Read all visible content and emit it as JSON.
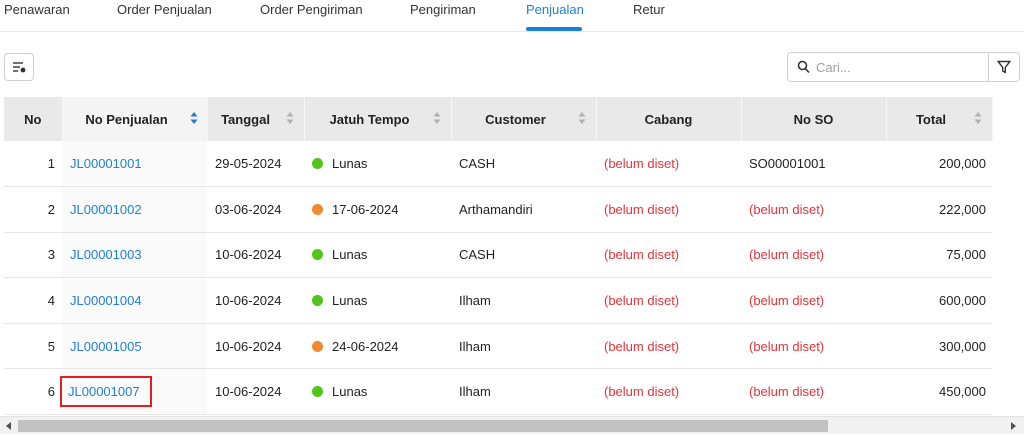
{
  "tabs": [
    {
      "label": "Penawaran",
      "active": false
    },
    {
      "label": "Order Penjualan",
      "active": false
    },
    {
      "label": "Order Pengiriman",
      "active": false
    },
    {
      "label": "Pengiriman",
      "active": false
    },
    {
      "label": "Penjualan",
      "active": true
    },
    {
      "label": "Retur",
      "active": false
    }
  ],
  "toolbar": {
    "filter_icon": "sort-filter-icon",
    "search_placeholder": "Cari...",
    "search_value": "",
    "funnel_icon": "funnel-icon"
  },
  "table": {
    "columns": [
      {
        "label": "No",
        "sortable": false
      },
      {
        "label": "No Penjualan",
        "sortable": true,
        "sorted": "ascending"
      },
      {
        "label": "Tanggal",
        "sortable": true
      },
      {
        "label": "Jatuh Tempo",
        "sortable": true
      },
      {
        "label": "Customer",
        "sortable": true
      },
      {
        "label": "Cabang",
        "sortable": false
      },
      {
        "label": "No SO",
        "sortable": false
      },
      {
        "label": "Total",
        "sortable": true
      }
    ],
    "rows": [
      {
        "no": "1",
        "no_penjualan": "JL00001001",
        "tanggal": "29-05-2024",
        "jatuh_tempo": "Lunas",
        "status": "paid",
        "customer": "CASH",
        "cabang": "(belum diset)",
        "no_so": "SO00001001",
        "no_so_set": true,
        "total": "200,000",
        "highlighted": false
      },
      {
        "no": "2",
        "no_penjualan": "JL00001002",
        "tanggal": "03-06-2024",
        "jatuh_tempo": "17-06-2024",
        "status": "due",
        "customer": "Arthamandiri",
        "cabang": "(belum diset)",
        "no_so": "(belum diset)",
        "no_so_set": false,
        "total": "222,000",
        "highlighted": false
      },
      {
        "no": "3",
        "no_penjualan": "JL00001003",
        "tanggal": "10-06-2024",
        "jatuh_tempo": "Lunas",
        "status": "paid",
        "customer": "CASH",
        "cabang": "(belum diset)",
        "no_so": "(belum diset)",
        "no_so_set": false,
        "total": "75,000",
        "highlighted": false
      },
      {
        "no": "4",
        "no_penjualan": "JL00001004",
        "tanggal": "10-06-2024",
        "jatuh_tempo": "Lunas",
        "status": "paid",
        "customer": "Ilham",
        "cabang": "(belum diset)",
        "no_so": "(belum diset)",
        "no_so_set": false,
        "total": "600,000",
        "highlighted": false
      },
      {
        "no": "5",
        "no_penjualan": "JL00001005",
        "tanggal": "10-06-2024",
        "jatuh_tempo": "24-06-2024",
        "status": "due",
        "customer": "Ilham",
        "cabang": "(belum diset)",
        "no_so": "(belum diset)",
        "no_so_set": false,
        "total": "300,000",
        "highlighted": false
      },
      {
        "no": "6",
        "no_penjualan": "JL00001007",
        "tanggal": "10-06-2024",
        "jatuh_tempo": "Lunas",
        "status": "paid",
        "customer": "Ilham",
        "cabang": "(belum diset)",
        "no_so": "(belum diset)",
        "no_so_set": false,
        "total": "450,000",
        "highlighted": true
      }
    ]
  },
  "colors": {
    "accent": "#1f7fd4",
    "paid_dot": "#52c41a",
    "due_dot": "#f08a30",
    "unset_text": "#e0343a",
    "highlight_box": "#e02020"
  }
}
